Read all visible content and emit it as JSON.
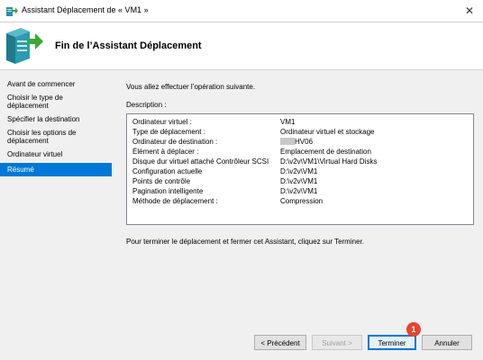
{
  "window": {
    "title": "Assistant Déplacement de « VM1 »",
    "close_label": "✕"
  },
  "header": {
    "title": "Fin de l’Assistant Déplacement"
  },
  "sidebar": {
    "items": [
      {
        "label": "Avant de commencer"
      },
      {
        "label": "Choisir le type de déplacement"
      },
      {
        "label": "Spécifier la destination"
      },
      {
        "label": "Choisir les options de déplacement"
      },
      {
        "label": "Ordinateur virtuel"
      },
      {
        "label": "Résumé",
        "selected": true
      }
    ]
  },
  "main": {
    "intro": "Vous allez effectuer l’opération suivante.",
    "description_label": "Description :",
    "rows": [
      {
        "key": "Ordinateur virtuel :",
        "value": "VM1"
      },
      {
        "key": "Type de déplacement :",
        "value": "Ordinateur virtuel et stockage"
      },
      {
        "key": "Ordinateur de destination :",
        "value": "HV06"
      },
      {
        "key": "Élément à déplacer :",
        "value": "Emplacement de destination"
      },
      {
        "key": "Disque dur virtuel attaché  Contrôleur SCSI",
        "value": "D:\\v2v\\VM1\\Virtual Hard Disks"
      },
      {
        "key": "Configuration actuelle",
        "value": "D:\\v2v\\VM1"
      },
      {
        "key": "Points de contrôle",
        "value": "D:\\v2v\\VM1"
      },
      {
        "key": "Pagination intelligente",
        "value": "D:\\v2v\\VM1"
      },
      {
        "key": "Méthode de déplacement :",
        "value": "Compression"
      }
    ],
    "footer_note": "Pour terminer le déplacement et fermer cet Assistant, cliquez sur Terminer."
  },
  "buttons": {
    "previous": "< Précédent",
    "next": "Suivant >",
    "finish": "Terminer",
    "cancel": "Annuler"
  },
  "annotation": {
    "badge": "1"
  },
  "colors": {
    "selection": "#0078d7",
    "badge": "#e8432e",
    "icon_green": "#3aa935",
    "icon_teal": "#2e8fa3"
  }
}
